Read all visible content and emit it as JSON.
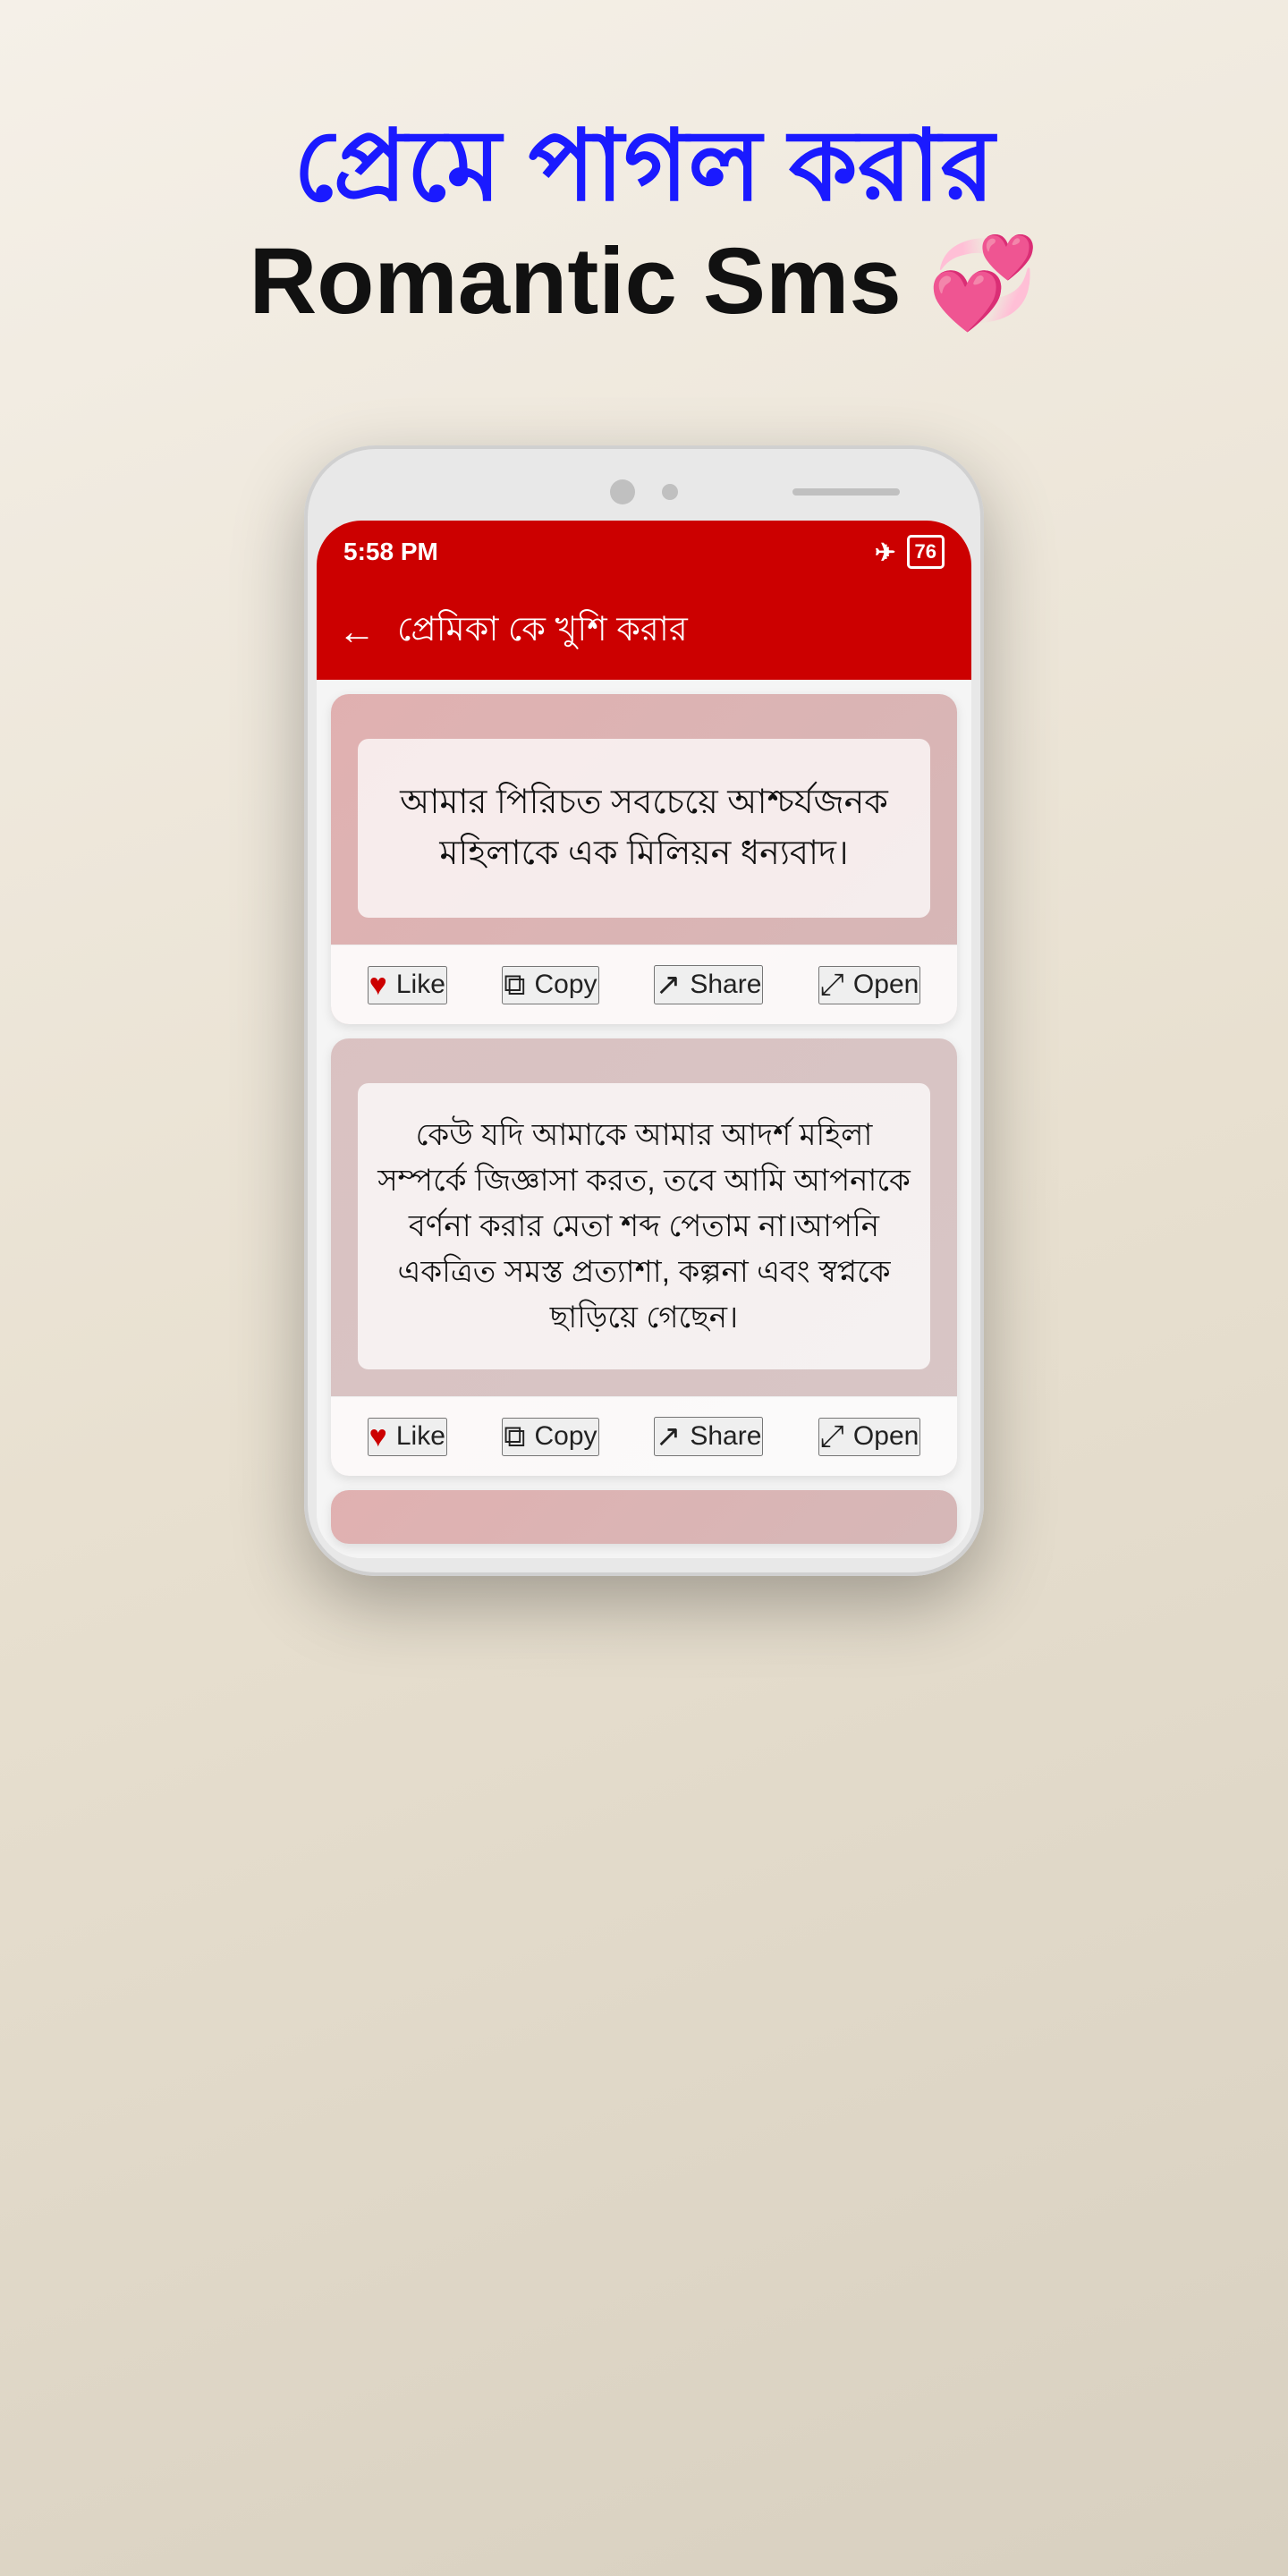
{
  "page": {
    "background": "linear-gradient(160deg, #f5f0e8, #e8e0d0, #d8d0c0)",
    "bengali_title": "প্রেমে পাগল করার",
    "english_title": "Romantic Sms",
    "title_emoji": "💞"
  },
  "phone": {
    "status_bar": {
      "time": "5:58 PM",
      "battery": "76"
    },
    "header": {
      "back_label": "←",
      "title": "প্রেমিকা কে খুশি করার"
    },
    "cards": [
      {
        "id": "card1",
        "text": "আমার পিরিচত সবচেয়ে আশ্চর্যজনক মহিলাকে এক মিলিয়ন ধন্যবাদ।",
        "actions": {
          "like": "Like",
          "copy": "Copy",
          "share": "Share",
          "open": "Open"
        }
      },
      {
        "id": "card2",
        "text": "কেউ যদি আমাকে আমার আদর্শ মহিলা সম্পর্কে জিজ্ঞাসা করত, তবে আমি আপনাকে বর্ণনা করার মেতা শব্দ পেতাম না।আপনি একত্রিত সমস্ত প্রত্যাশা, কল্পনা এবং স্বপ্নকে ছাড়িয়ে গেছেন।",
        "actions": {
          "like": "Like",
          "copy": "Copy",
          "share": "Share",
          "open": "Open"
        }
      }
    ]
  }
}
